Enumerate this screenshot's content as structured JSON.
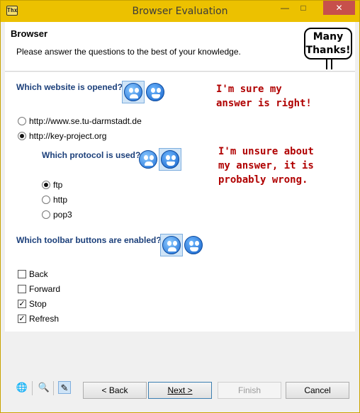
{
  "window": {
    "title": "Browser Evaluation",
    "app_icon_text": "Thx",
    "min": "—",
    "max": "□",
    "close": "✕"
  },
  "header": {
    "title": "Browser",
    "description": "Please answer the questions to the best of your knowledge.",
    "thanks_line1": "Many",
    "thanks_line2": "Thanks!"
  },
  "questions": [
    {
      "label": "Which website is opened?",
      "options": [
        "http://www.se.tu-darmstadt.de",
        "http://key-project.org"
      ],
      "selected": 1
    },
    {
      "label": "Which protocol is used?",
      "options": [
        "ftp",
        "http",
        "pop3"
      ],
      "selected": 0
    },
    {
      "label": "Which toolbar buttons are enabled?",
      "options": [
        "Back",
        "Forward",
        "Stop",
        "Refresh"
      ],
      "checked": [
        false,
        false,
        true,
        true
      ]
    }
  ],
  "annotations": {
    "sure": "I'm sure my\nanswer is right!",
    "unsure": "I'm unsure about\nmy answer, it is\nprobably wrong."
  },
  "footer": {
    "back_label": "< Back",
    "next_label": "Next >",
    "finish_label": "Finish",
    "cancel_label": "Cancel"
  },
  "colors": {
    "titlebar": "#ecc100",
    "question": "#1b3f7a",
    "annotation": "#b00000"
  }
}
